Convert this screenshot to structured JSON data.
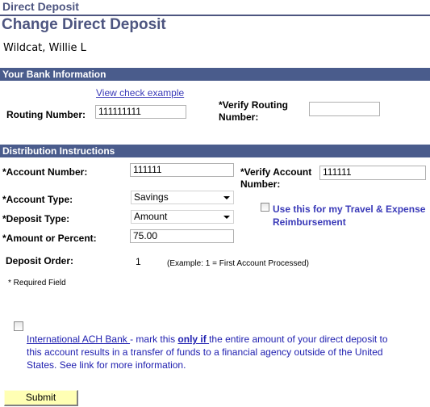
{
  "header": {
    "breadcrumb_title": "Direct Deposit",
    "page_title": "Change Direct Deposit",
    "employee_name": "Wildcat, Willie L"
  },
  "bank_info": {
    "section_title": "Your Bank Information",
    "view_check_link": "View check example",
    "routing_label": "Routing Number:",
    "routing_value": "111111111",
    "verify_routing_label_line1": "*Verify Routing",
    "verify_routing_label_line2": "Number:",
    "verify_routing_value": ""
  },
  "distribution": {
    "section_title": "Distribution Instructions",
    "account_number_label": "*Account Number:",
    "account_number_value": "111111",
    "verify_account_label_line1": "*Verify Account",
    "verify_account_label_line2": "Number:",
    "verify_account_value": "111111",
    "account_type_label": "*Account Type:",
    "account_type_value": "Savings",
    "deposit_type_label": "*Deposit Type:",
    "deposit_type_value": "Amount",
    "amount_label": "*Amount or Percent:",
    "amount_value": "75.00",
    "travel_checkbox_label_line1": "Use this for my Travel & Expense",
    "travel_checkbox_label_line2": "Reimbursement",
    "travel_checked": false,
    "deposit_order_label": "Deposit Order:",
    "deposit_order_value": "1",
    "deposit_order_hint": "(Example: 1 = First Account Processed)",
    "required_note": "* Required Field"
  },
  "international": {
    "checked": false,
    "link_text": "International ACH Bank ",
    "text_before_bold": "- mark this ",
    "bold_link": "only if ",
    "text_after_bold": "the entire amount of your direct deposit to",
    "line2": "this account results in a transfer of funds to a financial agency outside of the United",
    "line3": "States. See link for more information."
  },
  "actions": {
    "submit_label": "Submit"
  }
}
